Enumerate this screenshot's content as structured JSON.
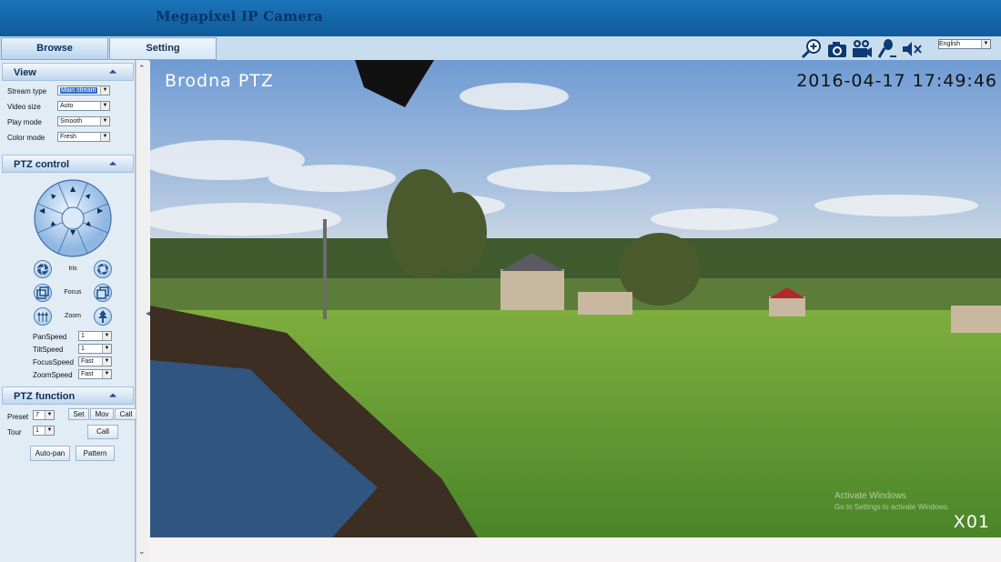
{
  "header": {
    "title": "Megapixel IP Camera"
  },
  "tabs": {
    "browse": "Browse",
    "setting": "Setting"
  },
  "toolbar": {
    "icons": [
      "zoom-in-icon",
      "camera-icon",
      "video-record-icon",
      "microphone-icon",
      "speaker-mute-icon"
    ],
    "language": "English"
  },
  "sidebar": {
    "view": {
      "title": "View",
      "stream_type_label": "Stream type",
      "stream_type": "Main stream",
      "video_size_label": "Video size",
      "video_size": "Auto",
      "play_mode_label": "Play mode",
      "play_mode": "Smooth",
      "color_mode_label": "Color mode",
      "color_mode": "Fresh"
    },
    "ptz_control": {
      "title": "PTZ control",
      "iris_label": "Iris",
      "focus_label": "Focus",
      "zoom_label": "Zoom",
      "pan_speed_label": "PanSpeed",
      "pan_speed": "1",
      "tilt_speed_label": "TiltSpeed",
      "tilt_speed": "1",
      "focus_speed_label": "FocusSpeed",
      "focus_speed": "Fast",
      "zoom_speed_label": "ZoomSpeed",
      "zoom_speed": "Fast"
    },
    "ptz_function": {
      "title": "PTZ function",
      "preset_label": "Preset",
      "preset": "7",
      "set": "Set",
      "mov": "Mov",
      "call": "Call",
      "tour_label": "Tour",
      "tour": "1",
      "tour_call": "Call",
      "auto_pan": "Auto-pan",
      "pattern": "Pattern"
    }
  },
  "video": {
    "osd_title": "Brodna  PTZ",
    "osd_datetime": "2016-04-17  17:49:46",
    "osd_channel": "X01",
    "watermark_line1": "Activate Windows",
    "watermark_line2": "Go to Settings to activate Windows."
  },
  "colors": {
    "header_bg": "#1565a9",
    "sidebar_bg": "#e2ecf5",
    "accent": "#0a3466"
  }
}
